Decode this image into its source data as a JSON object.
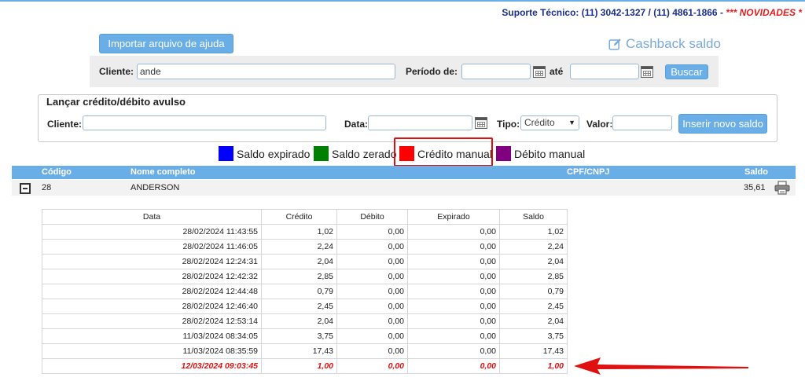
{
  "support": {
    "label": "Suporte Técnico:",
    "phone1": "(11) 3042-1327",
    "separator": "/",
    "phone2": "(11) 4861-1866",
    "dash": "-",
    "news": "*** NOVIDADES *"
  },
  "header": {
    "import_button": "Importar arquivo de ajuda",
    "cashback_title": "Cashback saldo",
    "cashback_icon": "edit-icon"
  },
  "search": {
    "client_label": "Cliente:",
    "client_value": "ande",
    "period_label": "Período de:",
    "period_from": "",
    "until_label": "até",
    "period_to": "",
    "search_button": "Buscar"
  },
  "entry": {
    "title": "Lançar crédito/débito avulso",
    "client_label": "Cliente:",
    "client_value": "",
    "date_label": "Data:",
    "date_value": "",
    "type_label": "Tipo:",
    "type_value": "Crédito",
    "value_label": "Valor:",
    "value_value": "",
    "insert_button": "Inserir novo saldo"
  },
  "legend": [
    {
      "label": "Saldo expirado",
      "color": "#0000ff"
    },
    {
      "label": "Saldo zerado",
      "color": "#008000"
    },
    {
      "label": "Crédito manual",
      "color": "#ff0000"
    },
    {
      "label": "Débito manual",
      "color": "#800080"
    }
  ],
  "main_table": {
    "headers": [
      "Código",
      "Nome completo",
      "CPF/CNPJ",
      "Saldo"
    ],
    "row": {
      "code": "28",
      "name": "ANDERSON",
      "cpf": "",
      "balance": "35,61"
    }
  },
  "detail_table": {
    "headers": [
      "Data",
      "Crédito",
      "Débito",
      "Expirado",
      "Saldo"
    ],
    "rows": [
      [
        "28/02/2024 11:43:55",
        "1,02",
        "0,00",
        "0,00",
        "1,02"
      ],
      [
        "28/02/2024 11:46:05",
        "2,24",
        "0,00",
        "0,00",
        "2,24"
      ],
      [
        "28/02/2024 12:24:31",
        "2,04",
        "0,00",
        "0,00",
        "2,04"
      ],
      [
        "28/02/2024 12:42:32",
        "2,85",
        "0,00",
        "0,00",
        "2,85"
      ],
      [
        "28/02/2024 12:44:48",
        "0,79",
        "0,00",
        "0,00",
        "0,79"
      ],
      [
        "28/02/2024 12:46:40",
        "2,45",
        "0,00",
        "0,00",
        "2,45"
      ],
      [
        "28/02/2024 12:53:14",
        "2,04",
        "0,00",
        "0,00",
        "2,04"
      ],
      [
        "11/03/2024 08:34:05",
        "3,75",
        "0,00",
        "0,00",
        "3,75"
      ],
      [
        "11/03/2024 08:35:59",
        "17,43",
        "0,00",
        "0,00",
        "17,43"
      ],
      [
        "12/03/2024 09:03:45",
        "1,00",
        "0,00",
        "0,00",
        "1,00"
      ]
    ]
  }
}
